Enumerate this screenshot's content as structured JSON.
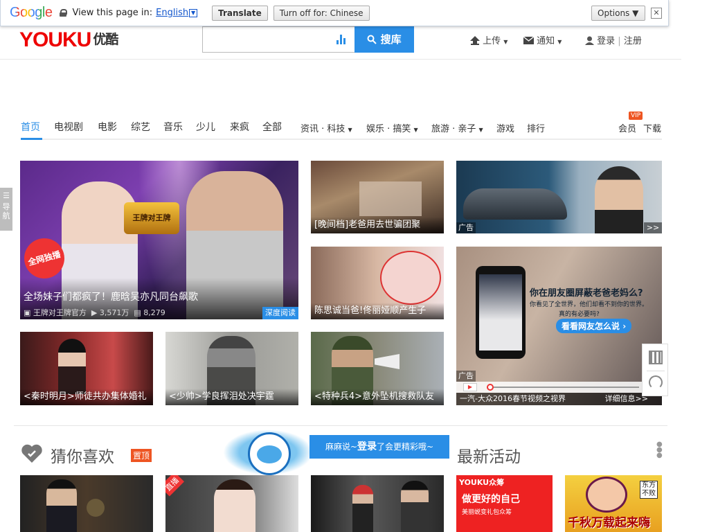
{
  "gtranslate": {
    "logo": "Google",
    "prompt": "View this page in:",
    "language": "English",
    "translate_label": "Translate",
    "turnoff_label": "Turn off for: Chinese",
    "options_label": "Options ▼",
    "close_glyph": "✕"
  },
  "header": {
    "logo_youku": "YOUKU",
    "logo_cn": "优酷",
    "search_button": "搜库",
    "upload": "上传",
    "notify": "通知",
    "login": "登录",
    "register": "注册"
  },
  "nav": {
    "items": [
      "首页",
      "电视剧",
      "电影",
      "综艺",
      "音乐",
      "少儿",
      "来疯",
      "全部"
    ],
    "dropdowns": [
      "资讯 · 科技",
      "娱乐 · 搞笑",
      "旅游 · 亲子"
    ],
    "games": "游戏",
    "rank": "排行",
    "vip_badge": "VIP",
    "member": "会员",
    "download": "下载"
  },
  "side_tab": "导航",
  "tiles": {
    "main": {
      "badge": "全网独播",
      "caption": "全场妹子们都疯了！鹿晗吴亦凡同台飙歌",
      "channel": "王牌对王牌官方",
      "plays": "3,571万",
      "comments": "8,279",
      "tag": "深度阅读",
      "stage_text": "王牌对王牌"
    },
    "t1": "[晚间档]老爸用去世骗团聚",
    "t2": "陈思诚当爸!佟丽娅顺产生子",
    "t3": "<秦时明月>师徒共办集体婚礼",
    "t4": "<少帅>学良挥泪处决宇霆",
    "t5": "<特种兵4>意外坠机搜救队友",
    "ad1": {
      "tag": "广告",
      "more": ">>"
    },
    "ad2": {
      "tag": "广告",
      "q1": "你在朋友圈屏蔽老爸老妈么?",
      "q2": "你看见了全世界，他们却看不到你的世界。",
      "q3": "真的有必要吗?",
      "btn": "看看网友怎么说",
      "caption": "一汽-大众2016春节视频之视界",
      "detail": "详细信息>>"
    }
  },
  "guess": {
    "title": "猜你喜欢",
    "pin": "置顶",
    "tip_prefix": "麻麻说~",
    "tip_login": "登录",
    "tip_suffix": "了会更精彩哦~",
    "activity": "最新活动",
    "live_tag": "直播",
    "promo_brand": "YOUKU众筹",
    "promo_text": "做更好的自己",
    "promo_sub": "美丽蜕变礼包众筹",
    "game_text": "千秋万载起来嗨",
    "game_tag": "东方不败"
  },
  "colors": {
    "accent": "#2a8ee6",
    "brand_red": "#e00",
    "brand_blue": "#06a7e2"
  }
}
